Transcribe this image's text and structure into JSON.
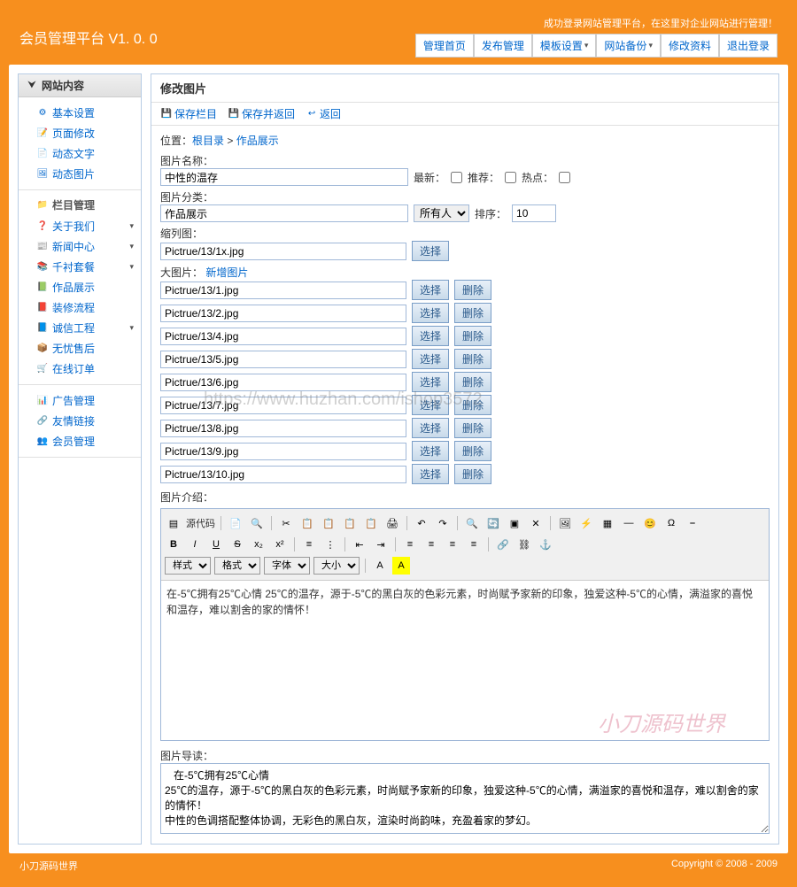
{
  "app_title": "会员管理平台  V1. 0. 0",
  "header_msg": "成功登录网站管理平台，在这里对企业网站进行管理！",
  "nav": [
    "管理首页",
    "发布管理",
    "模板设置",
    "网站备份",
    "修改资料",
    "退出登录"
  ],
  "nav_has_dropdown": [
    false,
    false,
    true,
    true,
    false,
    false
  ],
  "sidebar_header": "网站内容",
  "sidebar_sections": [
    {
      "items": [
        {
          "icon": "⚙",
          "label": "基本设置",
          "expand": false
        },
        {
          "icon": "📝",
          "label": "页面修改",
          "expand": false
        },
        {
          "icon": "📄",
          "label": "动态文字",
          "expand": false
        },
        {
          "icon": "🖼",
          "label": "动态图片",
          "expand": false
        }
      ]
    },
    {
      "title": "栏目管理",
      "title_icon": "📁",
      "items": [
        {
          "icon": "❓",
          "label": "关于我们",
          "expand": true
        },
        {
          "icon": "📰",
          "label": "新闻中心",
          "expand": true
        },
        {
          "icon": "📚",
          "label": "千衬套餐",
          "expand": true
        },
        {
          "icon": "📗",
          "label": "作品展示",
          "expand": false
        },
        {
          "icon": "📕",
          "label": "装修流程",
          "expand": false
        },
        {
          "icon": "📘",
          "label": "诚信工程",
          "expand": true
        },
        {
          "icon": "📦",
          "label": "无忧售后",
          "expand": false
        },
        {
          "icon": "🛒",
          "label": "在线订单",
          "expand": false
        }
      ]
    },
    {
      "items": [
        {
          "icon": "📊",
          "label": "广告管理",
          "expand": false
        },
        {
          "icon": "🔗",
          "label": "友情链接",
          "expand": false
        },
        {
          "icon": "👥",
          "label": "会员管理",
          "expand": false
        }
      ]
    }
  ],
  "content_title": "修改图片",
  "toolbar_btns": [
    {
      "icon": "💾",
      "label": "保存栏目"
    },
    {
      "icon": "💾",
      "label": "保存并返回"
    },
    {
      "icon": "↩",
      "label": "返回"
    }
  ],
  "breadcrumb": {
    "prefix": "位置：",
    "root": "根目录",
    "sep": " > ",
    "current": "作品展示"
  },
  "labels": {
    "pic_name": "图片名称：",
    "latest": "最新：",
    "recommend": "推荐：",
    "hot": "热点：",
    "category": "图片分类：",
    "order": "排序：",
    "thumb": "缩列图：",
    "bigpic": "大图片：",
    "add_pic": "新增图片",
    "intro": "图片介绍：",
    "guide": "图片导读："
  },
  "form": {
    "pic_name": "中性的温存",
    "category": "作品展示",
    "visibility": "所有人",
    "order": "10",
    "thumb": "Pictrue/13/1x.jpg"
  },
  "btn_select": "选择",
  "btn_delete": "删除",
  "big_pics": [
    "Pictrue/13/1.jpg",
    "Pictrue/13/2.jpg",
    "Pictrue/13/4.jpg",
    "Pictrue/13/5.jpg",
    "Pictrue/13/6.jpg",
    "Pictrue/13/7.jpg",
    "Pictrue/13/8.jpg",
    "Pictrue/13/9.jpg",
    "Pictrue/13/10.jpg"
  ],
  "editor": {
    "source_label": "源代码",
    "style": "样式",
    "format": "格式",
    "font": "字体",
    "size": "大小",
    "content": "在-5℃拥有25℃心情 25℃的温存，源于-5℃的黑白灰的色彩元素，时尚赋予家新的印象，独爱这种-5℃的心情，满溢家的喜悦 和温存，难以割舍的家的情怀！"
  },
  "guide_text": "   在-5℃拥有25℃心情\n25℃的温存，源于-5℃的黑白灰的色彩元素，时尚赋予家新的印象，独爱这种-5℃的心情，满溢家的喜悦和温存，难以割舍的家的情怀！\n中性的色调搭配整体协调，无彩色的黑白灰，渲染时尚韵味，充盈着家的梦幻。",
  "footer_left": "小刀源码世界",
  "footer_right": "Copyright © 2008 - 2009",
  "watermark": "小刀源码世界",
  "watermark2": "https://www.huzhan.com/ishop3572"
}
